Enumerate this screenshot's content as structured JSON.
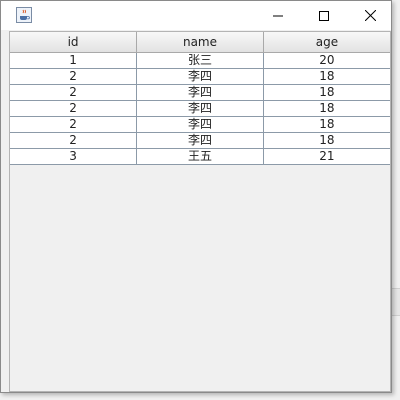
{
  "window": {
    "icon": "java-cup-icon",
    "controls": {
      "minimize": "minimize-icon",
      "maximize": "maximize-icon",
      "close": "close-icon"
    }
  },
  "background": {
    "partial_glyph": "r"
  },
  "table": {
    "columns": [
      "id",
      "name",
      "age"
    ],
    "rows": [
      [
        "1",
        "张三",
        "20"
      ],
      [
        "2",
        "李四",
        "18"
      ],
      [
        "2",
        "李四",
        "18"
      ],
      [
        "2",
        "李四",
        "18"
      ],
      [
        "2",
        "李四",
        "18"
      ],
      [
        "2",
        "李四",
        "18"
      ],
      [
        "3",
        "王五",
        "21"
      ]
    ]
  }
}
